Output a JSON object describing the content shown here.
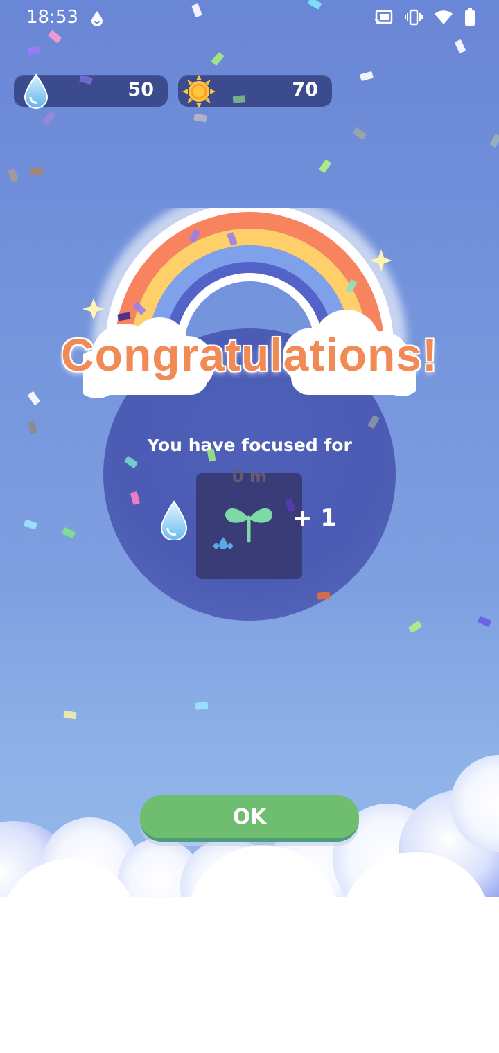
{
  "status_bar": {
    "time": "18:53",
    "icons": [
      "water-drop-notification-icon",
      "cast-icon",
      "vibrate-icon",
      "wifi-icon",
      "battery-icon"
    ]
  },
  "resources": {
    "water": {
      "value": "50",
      "icon": "water-drop-icon"
    },
    "sun": {
      "value": "70",
      "icon": "sun-icon"
    }
  },
  "dialog": {
    "title": "Congratulations!",
    "focused_label": "You have focused for",
    "focused_minutes": "0 m",
    "reward_amount": "+ 1",
    "reward_icon": "water-drop-icon",
    "plant_icon": "sprout-icon"
  },
  "ok_button": {
    "label": "OK"
  },
  "colors": {
    "title": "#f28a55",
    "ok_button": "#6fbe6f",
    "disc": "#4c5bb3",
    "pill": "#3b4b8e"
  }
}
